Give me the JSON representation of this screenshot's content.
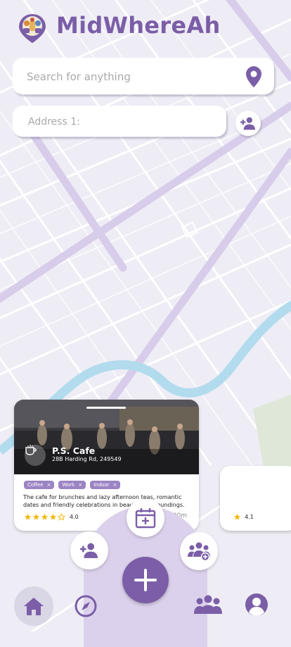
{
  "app": {
    "title": "MidWhereAh"
  },
  "search": {
    "placeholder": "Search for anything",
    "value": ""
  },
  "address": {
    "placeholder": "Address 1:",
    "value": ""
  },
  "place_cards": [
    {
      "name": "P.S. Cafe",
      "address": "28B Harding Rd, 249549",
      "tags": [
        "Coffee",
        "Work",
        "Indoor"
      ],
      "description": "The cafe for brunches and lazy afternoon teas, romantic dates and friendly celebrations in beautiful surroundings.",
      "rating": "4.0",
      "rating_stars": 4,
      "distance": "200m"
    },
    {
      "rating": "4.1",
      "rating_stars": 1
    }
  ],
  "actions": {
    "add_person_icon": "person-add-icon",
    "calendar_icon": "calendar-icon",
    "group_add_icon": "group-add-icon",
    "fab_icon": "plus-icon"
  },
  "bottom_nav": [
    "home-icon",
    "compass-icon",
    "groups-icon",
    "profile-icon"
  ],
  "colors": {
    "accent": "#7b5ea7",
    "accent_light": "#dcd1ec",
    "star": "#f5b800",
    "map_bg": "#eeedf5",
    "road_main": "#d8cceb",
    "river": "#b2dcee"
  }
}
